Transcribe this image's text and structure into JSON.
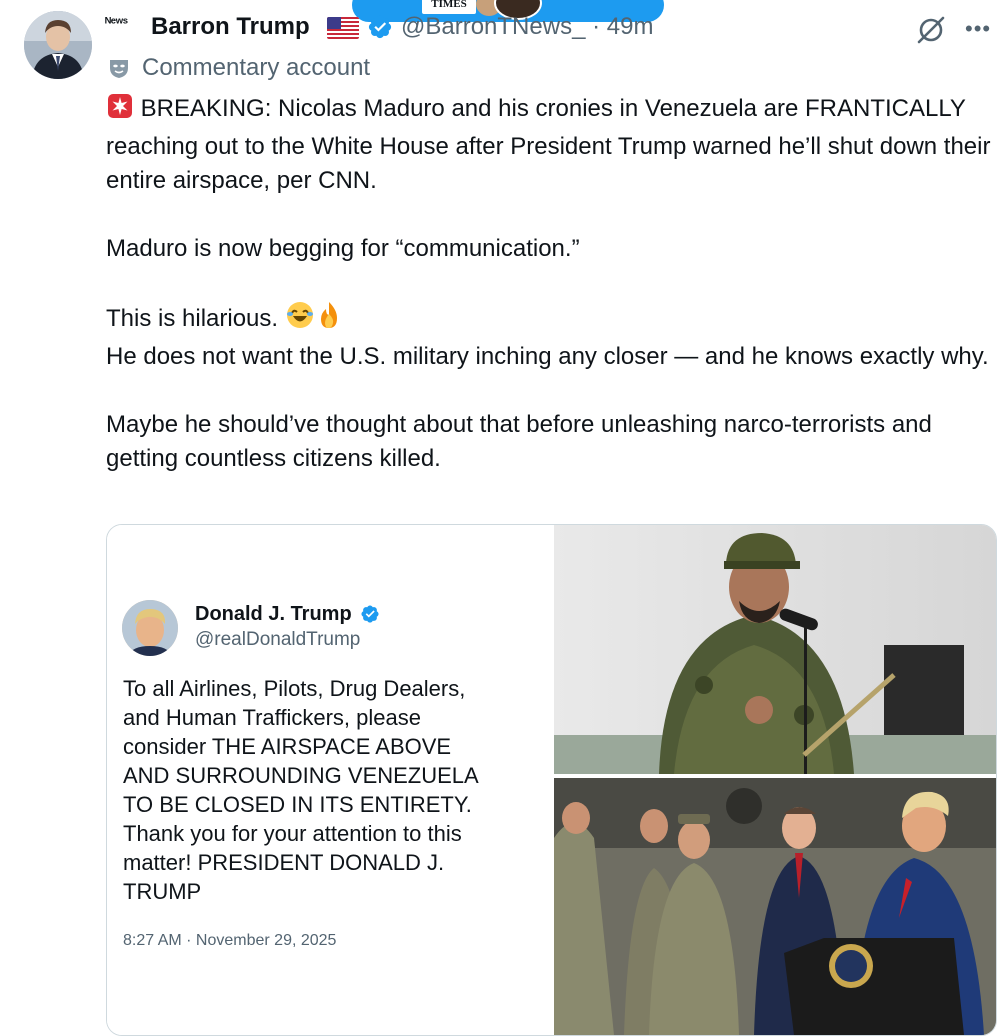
{
  "overlay": {
    "logo_text": "TIMES"
  },
  "author": {
    "news_badge": "ᴺᵉʷˢ",
    "name": "Barron Trump",
    "handle": "@BarronTNews_ · 49m",
    "label": "Commentary account"
  },
  "tweet": {
    "text": "🚨 BREAKING: Nicolas Maduro and his cronies in Venezuela are FRANTICALLY reaching out to the White House after President Trump warned he’ll shut down their entire airspace, per CNN.\n\nMaduro is now begging for “communication.”\n\nThis is hilarious. 🤣🔥\nHe does not want the U.S. military inching any closer — and he knows exactly why.\n\nMaybe he should’ve thought about that before unleashing narco-terrorists and getting countless citizens killed.",
    "text_part1": "BREAKING: Nicolas Maduro and his cronies in Venezuela are FRANTICALLY reaching out to the White House after President Trump warned he’ll shut down their entire airspace, per CNN.\n\nMaduro is now begging for “communication.”\n\nThis is hilarious. ",
    "text_part2": "\nHe does not want the U.S. military inching any closer — and he knows exactly why.\n\nMaybe he should’ve thought about that before unleashing narco-terrorists and getting countless citizens killed."
  },
  "embedded_card": {
    "name": "Donald J. Trump",
    "handle": "@realDonaldTrump",
    "body": "To all Airlines, Pilots, Drug Dealers,\nand Human Traffickers, please\nconsider THE AIRSPACE ABOVE\nAND SURROUNDING VENEZUELA\nTO BE CLOSED IN ITS ENTIRETY.\nThank you for your attention to this\nmatter! PRESIDENT DONALD J.\nTRUMP",
    "timestamp": "8:27 AM · November 29, 2025"
  },
  "colors": {
    "accent": "#1d9bf0",
    "secondary_text": "#536471",
    "border": "#cfd9de"
  },
  "icons": [
    "verified-badge-icon",
    "grok-icon",
    "more-icon",
    "mask-icon",
    "siren-emoji",
    "laughing-emoji",
    "fire-emoji",
    "us-flag-icon"
  ]
}
